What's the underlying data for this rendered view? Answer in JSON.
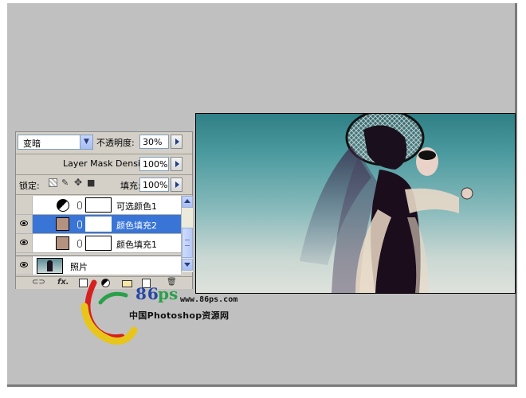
{
  "layers_panel": {
    "blend_mode": "变暗",
    "opacity_label": "不透明度:",
    "opacity_value": "30%",
    "mask_density_label": "Layer Mask Density",
    "mask_density_value": "100%",
    "lock_label": "锁定:",
    "fill_label": "填充:",
    "fill_value": "100%",
    "layers": [
      {
        "name": "可选颜色1",
        "visible": false,
        "type": "adjustment"
      },
      {
        "name": "颜色填充2",
        "visible": true,
        "selected": true,
        "type": "color-fill",
        "swatch": "#b59280"
      },
      {
        "name": "颜色填充1",
        "visible": true,
        "type": "color-fill",
        "swatch": "#b59280"
      }
    ],
    "background_layer": {
      "name": "照片",
      "visible": true
    },
    "bottom_icons": [
      "link-icon",
      "fx-icon",
      "add-mask-icon",
      "adjustment-layer-icon",
      "folder-icon",
      "new-layer-icon",
      "trash-icon"
    ],
    "bottom_fx_label": "fx."
  },
  "watermark": {
    "number": "86",
    "ps": "ps",
    "site": "www.86ps.com",
    "name": "中国Photoshop资源网"
  },
  "colors": {
    "selection": "#3875d7",
    "panel_bg": "#d4d0c8",
    "workspace_bg": "#c0c0c0"
  }
}
